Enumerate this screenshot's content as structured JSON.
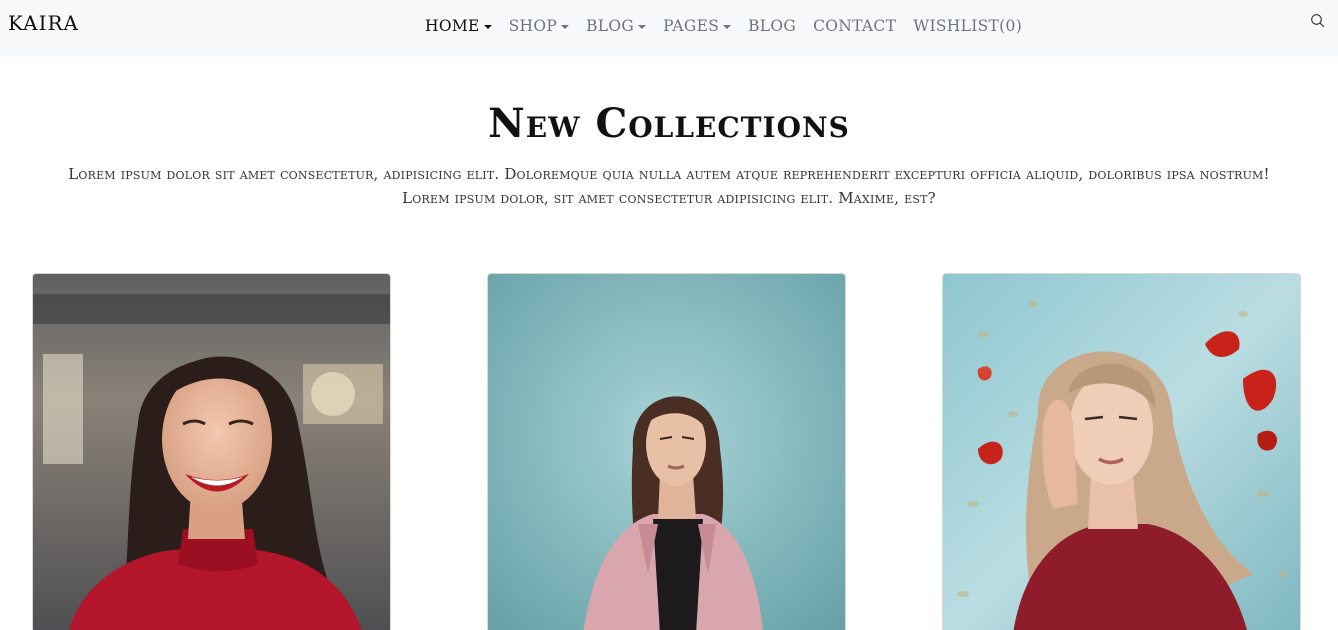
{
  "brand": "KAIRA",
  "nav": {
    "items": [
      {
        "label": "HOME",
        "dropdown": true,
        "active": true
      },
      {
        "label": "SHOP",
        "dropdown": true,
        "active": false
      },
      {
        "label": "BLOG",
        "dropdown": true,
        "active": false
      },
      {
        "label": "PAGES",
        "dropdown": true,
        "active": false
      },
      {
        "label": "BLOG",
        "dropdown": false,
        "active": false
      },
      {
        "label": "CONTACT",
        "dropdown": false,
        "active": false
      },
      {
        "label": "WISHLIST(0)",
        "dropdown": false,
        "active": false
      }
    ],
    "search_icon": "search-icon"
  },
  "collections": {
    "title": "New Collections",
    "description": "Lorem ipsum dolor sit amet consectetur, adipisicing elit. Doloremque quia nulla autem atque reprehenderit excepturi officia aliquid, doloribus ipsa nostrum! Lorem ipsum dolor, sit amet consectetur adipisicing elit. Maxime, est?",
    "products": [
      {
        "image": "woman-red-top-smiling-photo"
      },
      {
        "image": "woman-pink-denim-jacket-photo"
      },
      {
        "image": "woman-red-sweater-leaves-photo"
      }
    ]
  },
  "colors": {
    "navbar_bg": "#f8f9fa",
    "nav_active": "#111111",
    "nav_inactive": "#6c757d"
  }
}
